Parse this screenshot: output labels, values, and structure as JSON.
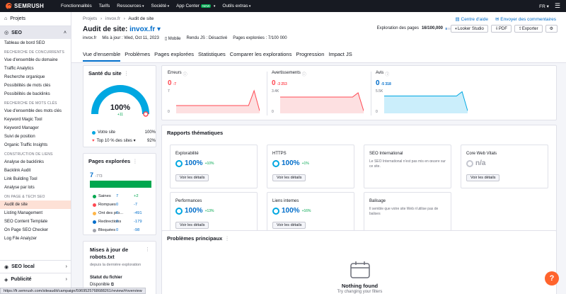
{
  "topbar": {
    "logo": "SEMRUSH",
    "nav": [
      "Fonctionnalités",
      "Tarifs",
      "Ressources",
      "Société",
      "App Center",
      "Outils extras"
    ],
    "new_badge": "NEW",
    "lang": "FR"
  },
  "sidebar": {
    "projects": "Projets",
    "seo": "SEO",
    "dashboard": "Tableau de bord SEO",
    "sections": [
      {
        "head": "RECHERCHE DE CONCURRENTS",
        "items": [
          "Vue d'ensemble du domaine",
          "Traffic Analytics",
          "Recherche organique",
          "Possibilités de mots clés",
          "Possibilités de backlinks"
        ]
      },
      {
        "head": "RECHERCHE DE MOTS CLÉS",
        "items": [
          "Vue d'ensemble des mots clés",
          "Keyword Magic Tool",
          "Keyword Manager",
          "Suivi de position",
          "Organic Traffic Insights"
        ]
      },
      {
        "head": "CONSTRUCTION DE LIENS",
        "items": [
          "Analyse de backlinks",
          "Backlink Audit",
          "Link Building Tool",
          "Analyse par lots"
        ]
      },
      {
        "head": "ON PAGE & TECH SEO",
        "items": [
          "Audit de site",
          "Listing Management",
          "SEO Content Template",
          "On Page SEO Checker",
          "Log File Analyzer"
        ]
      }
    ],
    "seo_local": "SEO local",
    "publicite": "Publicité"
  },
  "header": {
    "breadcrumb": [
      "Projets",
      "›",
      "invox.fr",
      "›",
      "Audit de site"
    ],
    "help_link": "Centre d'aide",
    "feedback_link": "Envoyer des commentaires",
    "title_prefix": "Audit de site:",
    "domain": "invox.fr",
    "meta": [
      "invox.fr",
      "Mis à jour : Wed, Oct 11, 2023",
      "Mobile",
      "Rendu JS : Désactivé",
      "Pages explorées : 7/100 000"
    ],
    "crawl_label": "Exploration des pages",
    "crawl_value": "16/100,000",
    "crawl_fraction": 0.00016,
    "buttons": [
      "Looker Studio",
      "PDF",
      "Exporter"
    ],
    "tabs": [
      "Vue d'ensemble",
      "Problèmes",
      "Pages explorées",
      "Statistiques",
      "Comparer les explorations",
      "Progression",
      "Impact JS"
    ]
  },
  "health": {
    "title": "Santé du site",
    "value": "100%",
    "delta": "+11",
    "legend": [
      {
        "label": "Votre site",
        "value": "100%",
        "color": "#00a7e1"
      },
      {
        "label": "Top 10 % des sites",
        "value": "92%",
        "color": "#ff4953"
      }
    ]
  },
  "stats": [
    {
      "label": "Erreurs",
      "value": "0",
      "delta": "-7",
      "color": "#ff4953",
      "ticks": [
        "7",
        "0"
      ],
      "series": [
        0.3,
        0.3,
        0.3,
        0.3,
        0.3,
        0.3,
        0.3,
        0.3,
        0.3,
        0.3,
        0.3,
        0.3,
        0.3,
        0.3,
        1.0,
        0.05
      ]
    },
    {
      "label": "Avertissements",
      "value": "0",
      "delta": "-3 253",
      "color": "#ff4953",
      "ticks": [
        "3.4K",
        "0"
      ],
      "series": [
        0.7,
        0.7,
        0.7,
        0.7,
        0.7,
        0.7,
        0.7,
        0.7,
        0.7,
        0.7,
        0.7,
        0.7,
        0.7,
        0.7,
        0.9,
        0.05
      ]
    },
    {
      "label": "Avis",
      "value": "0",
      "delta": "-5 318",
      "color": "#00a7e1",
      "ticks": [
        "5.5K",
        "0"
      ],
      "series": [
        0.75,
        0.75,
        0.75,
        0.75,
        0.75,
        0.75,
        0.75,
        0.75,
        0.75,
        0.75,
        0.75,
        0.75,
        0.75,
        0.75,
        0.95,
        0.05
      ]
    }
  ],
  "pages": {
    "title": "Pages explorées",
    "total": "7",
    "total_delta": "-773",
    "rows": [
      {
        "label": "Saines",
        "n": "7",
        "c": "+2",
        "color": "#00a74f"
      },
      {
        "label": "Rompues",
        "n": "0",
        "c": "-7",
        "color": "#ff4953"
      },
      {
        "label": "Ont des pro...",
        "n": "0",
        "c": "-491",
        "color": "#ffb648"
      },
      {
        "label": "Redirections",
        "n": "0",
        "c": "-179",
        "color": "#006dca"
      },
      {
        "label": "Bloquées",
        "n": "0",
        "c": "-98",
        "color": "#a0a2ab"
      }
    ]
  },
  "robots": {
    "title_line1": "Mises à jour de",
    "title_line2": "robots.txt",
    "sub": "depuis la dernière exploration",
    "status_label": "Statut du fichier",
    "status_value": "Disponible"
  },
  "themes": {
    "title": "Rapports thématiques",
    "details": "Voir les détails",
    "cards": [
      {
        "name": "Explorabilité",
        "value": "100%",
        "delta": "+10%"
      },
      {
        "name": "HTTPS",
        "value": "100%",
        "delta": "+1%"
      },
      {
        "name": "SEO International",
        "desc": "Le SEO International n'est pas mis en œuvre sur ce site."
      },
      {
        "name": "Core Web Vitals",
        "value": "n/a",
        "delta": ""
      },
      {
        "name": "Performances",
        "value": "100%",
        "delta": "+13%"
      },
      {
        "name": "Liens internes",
        "value": "100%",
        "delta": "+16%"
      },
      {
        "name": "Balisage",
        "desc": "Il semble que votre site Web n'utilise pas de balises"
      }
    ]
  },
  "problems": {
    "title": "Problèmes principaux",
    "empty_title": "Nothing found",
    "empty_sub": "Try changing your filters"
  },
  "statusbar": "https://fr.semrush.com/siteaudit/campaign/5969525768688261/review/#overview"
}
